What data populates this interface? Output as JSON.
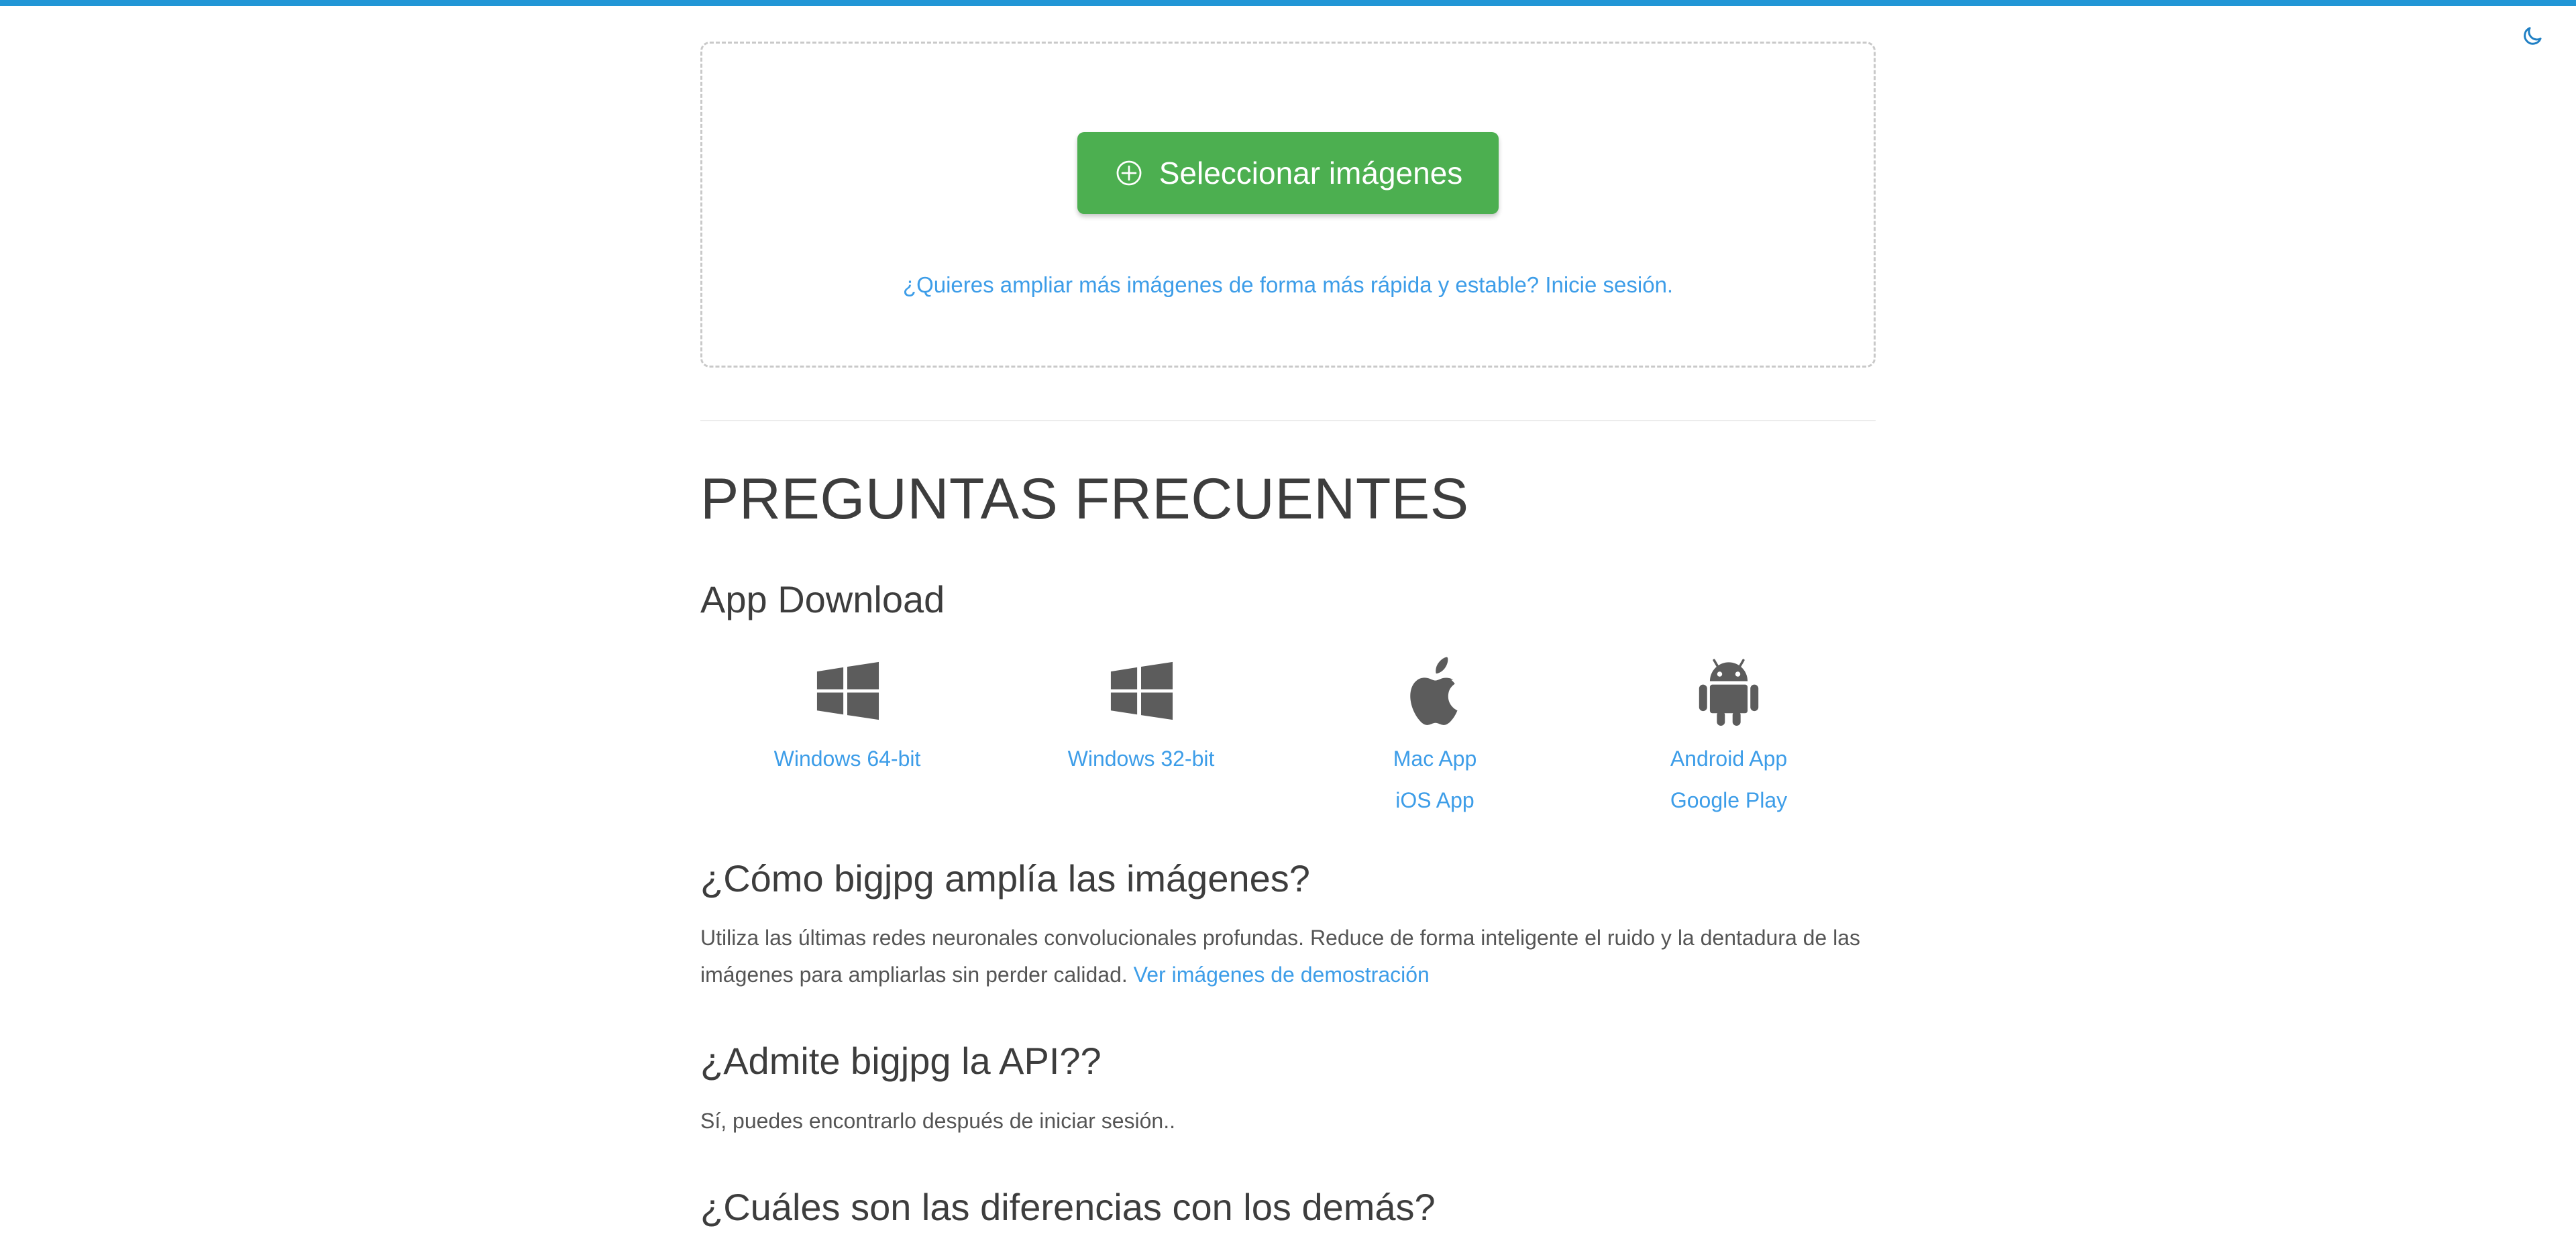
{
  "topbar": {
    "color": "#2196d6"
  },
  "header": {
    "dark_mode_toggle": "moon-icon"
  },
  "dropzone": {
    "select_button_label": "Seleccionar imágenes",
    "select_button_icon": "plus-circle-icon",
    "login_hint": "¿Quieres ampliar más imágenes de forma más rápida y estable? Inicie sesión.",
    "accent_color": "#4caf50",
    "link_color": "#3d9de8"
  },
  "faq": {
    "title": "PREGUNTAS FRECUENTES",
    "app_download": {
      "heading": "App Download",
      "columns": [
        {
          "icon": "windows-icon",
          "links": [
            "Windows 64-bit"
          ]
        },
        {
          "icon": "windows-icon",
          "links": [
            "Windows 32-bit"
          ]
        },
        {
          "icon": "apple-icon",
          "links": [
            "Mac App",
            "iOS App"
          ]
        },
        {
          "icon": "android-icon",
          "links": [
            "Android App",
            "Google Play"
          ]
        }
      ]
    },
    "questions": [
      {
        "heading": "¿Cómo bigjpg amplía las imágenes?",
        "body": "Utiliza las últimas redes neuronales convolucionales profundas. Reduce de forma inteligente el ruido y la dentadura de las imágenes para ampliarlas sin perder calidad. ",
        "link": "Ver imágenes de demostración"
      },
      {
        "heading": "¿Admite bigjpg la API??",
        "body": "Sí, puedes encontrarlo después de iniciar sesión..",
        "link": ""
      },
      {
        "heading": "¿Cuáles son las diferencias con los demás?",
        "body": "",
        "link": ""
      }
    ]
  }
}
